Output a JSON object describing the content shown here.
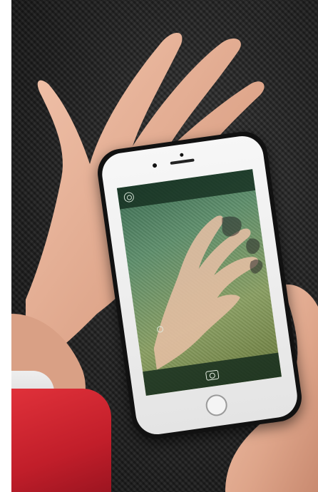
{
  "scene": {
    "description_icons": [
      "settings-icon",
      "lens-icon",
      "shutter-icon"
    ],
    "colors": {
      "background": "#262626",
      "skin": "#e8b49a",
      "sleeve": "#d42632",
      "screen_tint": "#5f8f6c",
      "phone_body": "#f2f2f2"
    }
  }
}
